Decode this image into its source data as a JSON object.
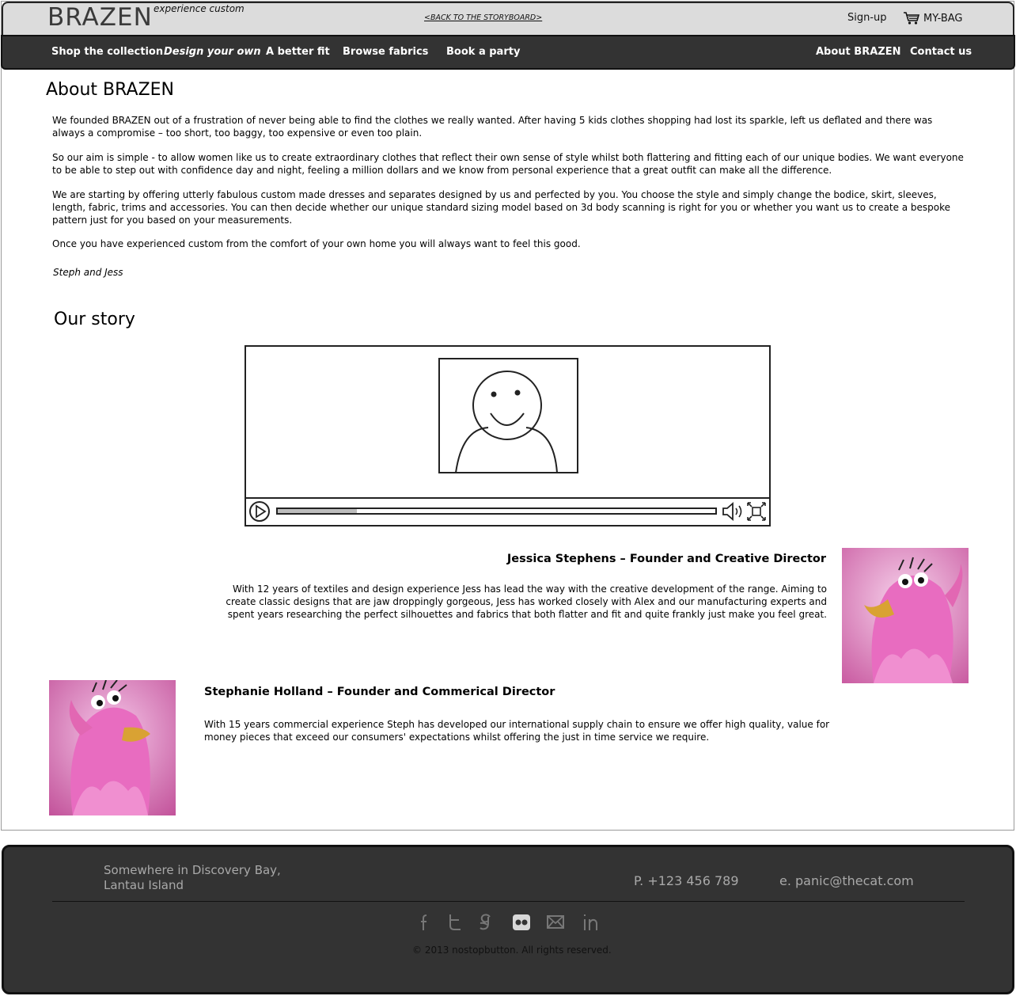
{
  "header": {
    "logo": "BRAZEN",
    "tagline": "experience custom",
    "back_link": "<BACK TO THE STORYBOARD>",
    "signup": "Sign-up",
    "bag": "MY-BAG"
  },
  "nav": {
    "items": [
      "Shop the collection",
      "Design your own",
      "A better fit",
      "Browse fabrics",
      "Book a party"
    ],
    "right_items": [
      "About BRAZEN",
      "Contact us"
    ]
  },
  "about": {
    "title": "About BRAZEN",
    "paragraphs": [
      "We founded BRAZEN out of a frustration of never being able to find the clothes we really wanted. After having 5 kids clothes shopping had lost its sparkle, left us deflated and there was always a compromise – too short, too baggy, too expensive or even too plain.",
      "So our aim is simple - to allow women like us to create extraordinary clothes that reflect their own sense of style whilst both flattering and fitting each of our unique bodies. We want everyone to be able to step out with confidence day and night, feeling a million dollars and we know from personal experience that a great outfit can make all the difference.",
      "We are starting by offering utterly fabulous custom made dresses and separates designed by us and perfected by you. You choose the style and simply change the bodice, skirt, sleeves, length, fabric, trims and accessories. You can then decide whether our unique standard sizing model based on 3d body scanning is right for you or whether you want us to create a bespoke pattern just for you based on your measurements.",
      "Once you have experienced custom from the comfort of your own home you will always want to feel this good."
    ],
    "signature": "Steph and Jess"
  },
  "story": {
    "title": "Our story",
    "video_progress": 0.18
  },
  "founders": [
    {
      "name": "Jessica Stephens – Founder and Creative Director",
      "bio": "With 12 years of textiles and design experience Jess has lead the way with the creative development of the range. Aiming to create classic designs that are jaw droppingly gorgeous, Jess has worked closely with Alex and our manufacturing experts and spent years researching the perfect silhouettes and fabrics that both flatter and fit and quite frankly just make you feel great."
    },
    {
      "name": "Stephanie Holland – Founder and Commerical Director",
      "bio": "With 15 years commercial experience Steph has developed our international supply chain to ensure we offer high quality, value for money pieces that exceed our consumers' expectations whilst offering the just in time service we require."
    }
  ],
  "footer": {
    "address": "Somewhere in Discovery Bay, Lantau Island",
    "phone": "P. +123 456 789",
    "email": "e. panic@thecat.com",
    "social_icons": [
      "facebook-icon",
      "twitter-icon",
      "google-icon",
      "flickr-icon",
      "mail-icon",
      "linkedin-icon"
    ],
    "copyright": "© 2013 nostopbutton. All rights reserved."
  },
  "colors": {
    "nav_bg": "#333333",
    "topbar_bg": "#dcdcdc",
    "puppet_pink": "#e86cc0"
  }
}
